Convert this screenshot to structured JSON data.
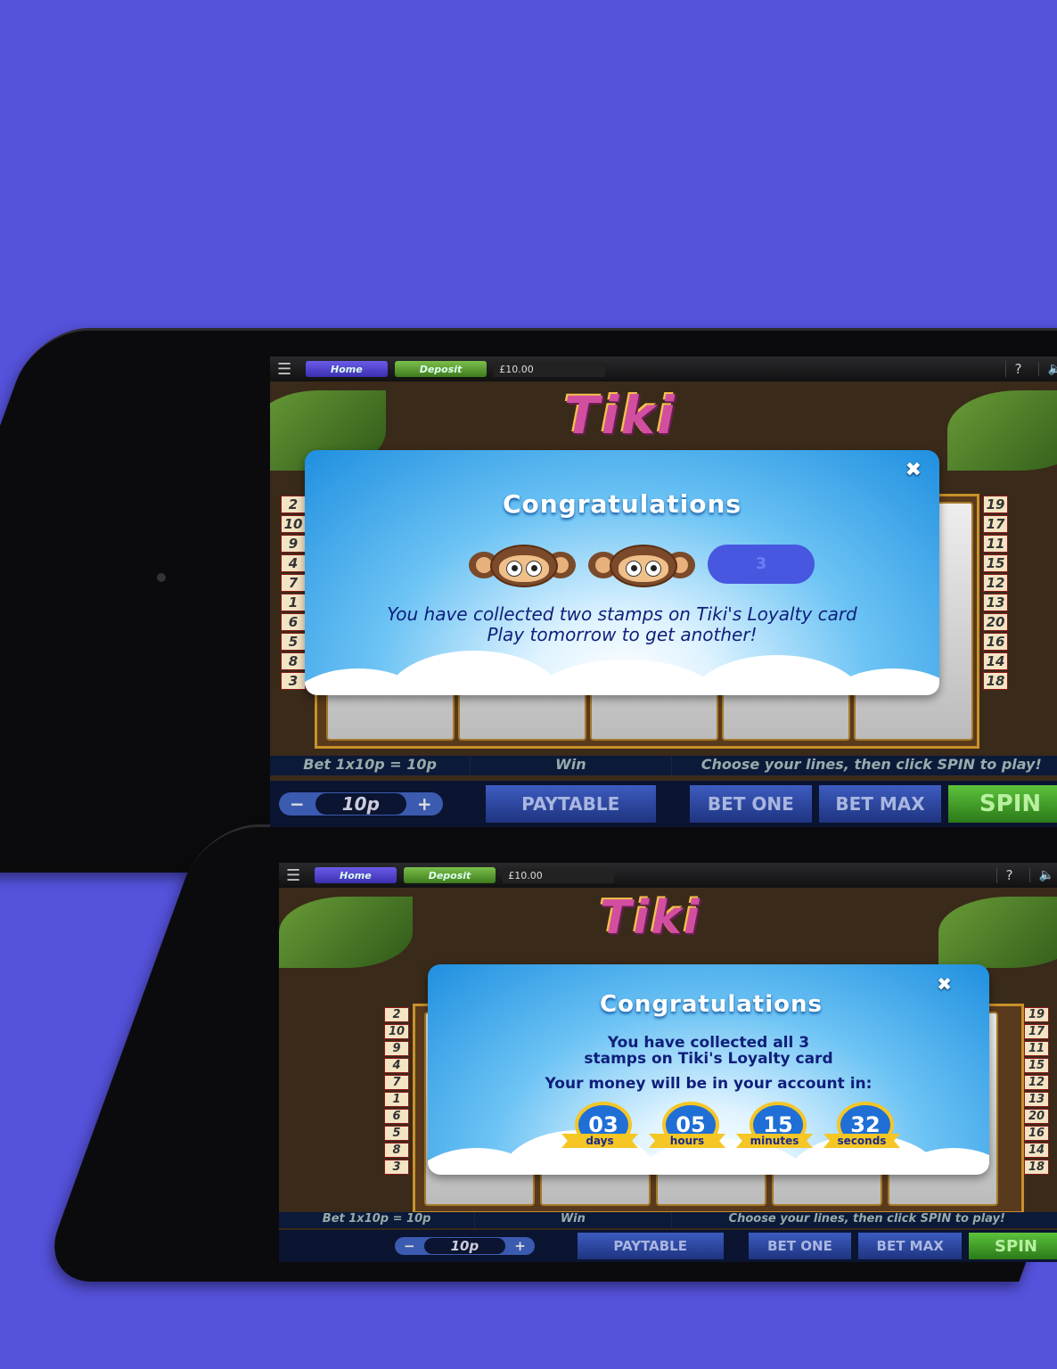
{
  "colors": {
    "background": "#5552dc",
    "popup_text": "#0f1f7a",
    "countdown_gold": "#f5c624"
  },
  "game": {
    "menu_icon": "hamburger-menu-icon",
    "home_label": "Home",
    "deposit_label": "Deposit",
    "balance": "£10.00",
    "help_label": "?",
    "sound_icon": "speaker-icon",
    "logo_text": "Tiki",
    "left_lines": [
      "2",
      "10",
      "9",
      "4",
      "7",
      "1",
      "6",
      "5",
      "8",
      "3"
    ],
    "right_lines": [
      "19",
      "17",
      "11",
      "15",
      "12",
      "13",
      "20",
      "16",
      "14",
      "18"
    ],
    "bet_info": "Bet 1x10p = 10p",
    "win_label": "Win",
    "instruction": "Choose your lines, then click SPIN to play!",
    "bet_value": "10p",
    "minus": "−",
    "plus": "+",
    "paytable": "PAYTABLE",
    "bet_one": "BET ONE",
    "bet_max": "BET MAX",
    "spin": "SPIN"
  },
  "popup1": {
    "close": "✖",
    "title": "Congratulations",
    "empty_stamp_number": "3",
    "line1": "You have collected two stamps on Tiki's Loyalty card",
    "line2": "Play tomorrow to get another!"
  },
  "popup2": {
    "close": "✖",
    "title": "Congratulations",
    "line1": "You have collected all 3",
    "line2": "stamps on Tiki's Loyalty card",
    "line3": "Your money will be in your account in:",
    "countdown": [
      {
        "value": "03",
        "unit": "days"
      },
      {
        "value": "05",
        "unit": "hours"
      },
      {
        "value": "15",
        "unit": "minutes"
      },
      {
        "value": "32",
        "unit": "seconds"
      }
    ]
  }
}
